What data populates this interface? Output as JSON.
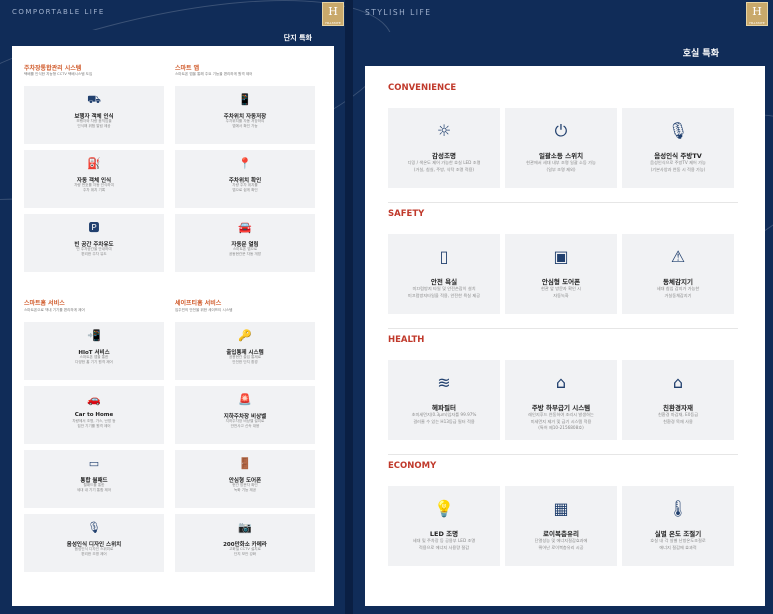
{
  "left_page": {
    "running_head": "COMPORTABLE LIFE",
    "tab": "단지 특화",
    "sections": [
      {
        "title": "주차장통합관리 시스템",
        "sub": "택배를 인식한 지능형 CCTV 택배시스템 도입",
        "cards": [
          {
            "icon": "car-camera-icon",
            "glyph": "⛟",
            "title": "보행자 객체 인식",
            "desc": "보행자와 차량 움직임을\n인식해 위험 알림 제공"
          },
          {
            "icon": "car-charge-icon",
            "glyph": "⛽",
            "title": "자동 객체 인식",
            "desc": "차량 번호를 자동 인식하여\n주차 위치 기록"
          }
        ]
      },
      {
        "title": "스마트 앱",
        "sub": "스마트폰 앱을 통해 주요 기능을 편리하게 원격 제어",
        "cards": [
          {
            "icon": "parking-app-icon",
            "glyph": "📱",
            "title": "주차위치 자동저장",
            "desc": "주차위치를 자동 저장하여\n앱에서 확인 가능"
          },
          {
            "icon": "location-icon",
            "glyph": "📍",
            "title": "주차위치 확인",
            "desc": "차량 주차 위치를\n앱으로 쉽게 확인"
          }
        ]
      }
    ],
    "extra_cards": [
      {
        "icon": "empty-space-icon",
        "glyph": "🅿",
        "title": "빈 공간 주차유도",
        "desc": "빈 주차공간을 안내하여\n편리한 주차 유도"
      },
      {
        "icon": "vehicle-call-icon",
        "glyph": "🚘",
        "title": "자동문 열림",
        "desc": "스마트폰 앱으로\n공동현관문 자동 개방"
      }
    ],
    "sections2": [
      {
        "title": "스마트홈 서비스",
        "sub": "스마트폰으로 댁내 기기를 편리하게 제어"
      },
      {
        "title": "세이프티홈 서비스",
        "sub": "입주민의 안전을 위한 세이프티 시스템"
      }
    ],
    "cards2": [
      {
        "icon": "hiot-icon",
        "glyph": "📲",
        "title": "HIoT 서비스",
        "desc": "스마트폰 앱을 통한\n다양한 홈 기기 원격 제어"
      },
      {
        "icon": "entry-icon",
        "glyph": "🔑",
        "title": "출입통제 시스템",
        "desc": "공용현관 출입 통제로\n안전한 단지 환경"
      },
      {
        "icon": "car-home-icon",
        "glyph": "🚗",
        "title": "Car to Home",
        "desc": "차량에서 조명, 가스, 난방 등\n집안 기기를 원격 제어"
      },
      {
        "icon": "parking-emergency-icon",
        "glyph": "🚨",
        "title": "지하주차장 비상벨",
        "desc": "지하주차장 비상벨 설치로\n안전사고 신속 대응"
      },
      {
        "icon": "wallpad-icon",
        "glyph": "▭",
        "title": "통합 월패드",
        "desc": "월패드를 통한\n세대 내 기기 통합 제어"
      },
      {
        "icon": "safe-door-icon",
        "glyph": "🚪",
        "title": "안심형 도어폰",
        "desc": "현관 방문자 확인\n녹화 기능 제공"
      },
      {
        "icon": "voice-switch-icon",
        "glyph": "🎙",
        "title": "음성인식 디자인 스위치",
        "desc": "음성인식 디자인 스위치로\n편리한 조명 제어"
      },
      {
        "icon": "cctv-icon",
        "glyph": "📷",
        "title": "200만화소 카메라",
        "desc": "고화질 CCTV 설치로\n단지 보안 강화"
      }
    ]
  },
  "right_page": {
    "running_head": "STYLISH LIFE",
    "tab": "호실 특화",
    "sections": [
      {
        "title": "CONVENIENCE",
        "cards": [
          {
            "icon": "ceiling-light-icon",
            "glyph": "☼",
            "title": "감성조명",
            "desc": "디밍 / 색온도 제어 가능한 호실 LED 조명\n(거실, 침실, 주방, 식탁 조명 적용)"
          },
          {
            "icon": "power-switch-icon",
            "glyph": "⏻",
            "title": "일괄소등 스위치",
            "desc": "현관에서 세대 내부 조명 일괄 소등 가능\n(일부 조명 제외)"
          },
          {
            "icon": "microphone-icon",
            "glyph": "🎙",
            "title": "음성인식 주방TV",
            "desc": "음성인식으로 주방TV 제어 가능\n(기본사양과 연동 시 적용 가능)"
          }
        ]
      },
      {
        "title": "SAFETY",
        "cards": [
          {
            "icon": "bathroom-icon",
            "glyph": "▯",
            "title": "안전 욕실",
            "desc": "미끄럼방지 타일 및 안전손잡이 설치\n미끄럼방지타일을 적용, 안전한 욕실 제공"
          },
          {
            "icon": "doorphone-icon",
            "glyph": "▣",
            "title": "안심형 도어폰",
            "desc": "현관 앞 방문자 확인 시\n자동녹화"
          },
          {
            "icon": "motion-sensor-icon",
            "glyph": "⚠",
            "title": "동체감지기",
            "desc": "세대 침입 감지가 가능한\n거실동체감지기"
          }
        ]
      },
      {
        "title": "HEALTH",
        "cards": [
          {
            "icon": "air-filter-icon",
            "glyph": "≋",
            "title": "헤파필터",
            "desc": "초미세먼지(0.3μm)입자를 99.97%\n걸러줄 수 있는 H13등급 필터 적용"
          },
          {
            "icon": "range-hood-icon",
            "glyph": "⌂",
            "title": "주방 하부급기 시스템",
            "desc": "레인지후드 연동하여 조리시 발생하는\n미세먼지 제거 및 급기 시스템 적용\n(특허 제10-2156808호)"
          },
          {
            "icon": "eco-house-icon",
            "glyph": "⌂",
            "title": "친환경자재",
            "desc": "친환경 마감재, E0등급\n친환경 목재 사용"
          }
        ]
      },
      {
        "title": "ECONOMY",
        "cards": [
          {
            "icon": "led-bulb-icon",
            "glyph": "💡",
            "title": "LED 조명",
            "desc": "세대 및 주차장 등 공용부 LED 조명\n적용으로 에너지 사용량 절감"
          },
          {
            "icon": "low-e-glass-icon",
            "glyph": "▦",
            "title": "로이복층유리",
            "desc": "단열성능 및 에너지절감효과에\n뛰어난 로이복층유리 시공"
          },
          {
            "icon": "thermostat-icon",
            "glyph": "🌡",
            "title": "실별 온도 조절기",
            "desc": "호실 내 각 실별 난방온도조절로\n에너지 절감에 효과적"
          }
        ]
      }
    ]
  }
}
